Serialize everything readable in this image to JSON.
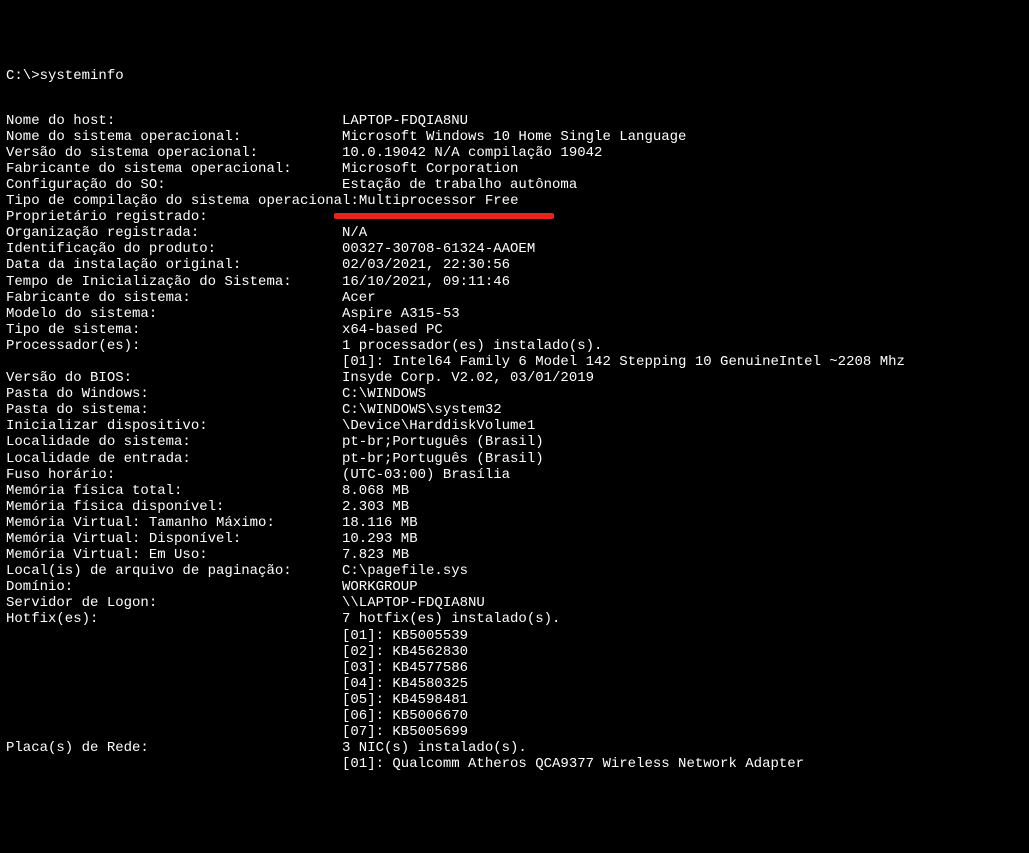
{
  "prompt": "C:\\>systeminfo",
  "rows": [
    {
      "label": "Nome do host:",
      "value": "LAPTOP-FDQIA8NU"
    },
    {
      "label": "Nome do sistema operacional:",
      "value": "Microsoft Windows 10 Home Single Language"
    },
    {
      "label": "Versão do sistema operacional:",
      "value": "10.0.19042 N/A compilação 19042"
    },
    {
      "label": "Fabricante do sistema operacional:",
      "value": "Microsoft Corporation"
    },
    {
      "label": "Configuração do SO:",
      "value": "Estação de trabalho autônoma"
    },
    {
      "label": "Tipo de compilação do sistema operacional:",
      "value": "Multiprocessor Free"
    },
    {
      "label": "Proprietário registrado:",
      "value": "",
      "redacted": true
    },
    {
      "label": "Organização registrada:",
      "value": "N/A"
    },
    {
      "label": "Identificação do produto:",
      "value": "00327-30708-61324-AAOEM"
    },
    {
      "label": "Data da instalação original:",
      "value": "02/03/2021, 22:30:56"
    },
    {
      "label": "Tempo de Inicialização do Sistema:",
      "value": "16/10/2021, 09:11:46"
    },
    {
      "label": "Fabricante do sistema:",
      "value": "Acer"
    },
    {
      "label": "Modelo do sistema:",
      "value": "Aspire A315-53"
    },
    {
      "label": "Tipo de sistema:",
      "value": "x64-based PC"
    },
    {
      "label": "Processador(es):",
      "value": "1 processador(es) instalado(s)."
    },
    {
      "label": "",
      "value": "[01]: Intel64 Family 6 Model 142 Stepping 10 GenuineIntel ~2208 Mhz",
      "indent": true
    },
    {
      "label": "Versão do BIOS:",
      "value": "Insyde Corp. V2.02, 03/01/2019"
    },
    {
      "label": "Pasta do Windows:",
      "value": "C:\\WINDOWS"
    },
    {
      "label": "Pasta do sistema:",
      "value": "C:\\WINDOWS\\system32"
    },
    {
      "label": "Inicializar dispositivo:",
      "value": "\\Device\\HarddiskVolume1"
    },
    {
      "label": "Localidade do sistema:",
      "value": "pt-br;Português (Brasil)"
    },
    {
      "label": "Localidade de entrada:",
      "value": "pt-br;Português (Brasil)"
    },
    {
      "label": "Fuso horário:",
      "value": "(UTC-03:00) Brasília"
    },
    {
      "label": "Memória física total:",
      "value": "8.068 MB"
    },
    {
      "label": "Memória física disponível:",
      "value": "2.303 MB"
    },
    {
      "label": "Memória Virtual: Tamanho Máximo:",
      "value": "18.116 MB"
    },
    {
      "label": "Memória Virtual: Disponível:",
      "value": "10.293 MB"
    },
    {
      "label": "Memória Virtual: Em Uso:",
      "value": "7.823 MB"
    },
    {
      "label": "Local(is) de arquivo de paginação:",
      "value": "C:\\pagefile.sys"
    },
    {
      "label": "Domínio:",
      "value": "WORKGROUP"
    },
    {
      "label": "Servidor de Logon:",
      "value": "\\\\LAPTOP-FDQIA8NU"
    },
    {
      "label": "Hotfix(es):",
      "value": "7 hotfix(es) instalado(s)."
    },
    {
      "label": "",
      "value": "[01]: KB5005539",
      "indent": true
    },
    {
      "label": "",
      "value": "[02]: KB4562830",
      "indent": true
    },
    {
      "label": "",
      "value": "[03]: KB4577586",
      "indent": true
    },
    {
      "label": "",
      "value": "[04]: KB4580325",
      "indent": true
    },
    {
      "label": "",
      "value": "[05]: KB4598481",
      "indent": true
    },
    {
      "label": "",
      "value": "[06]: KB5006670",
      "indent": true
    },
    {
      "label": "",
      "value": "[07]: KB5005699",
      "indent": true
    },
    {
      "label": "Placa(s) de Rede:",
      "value": "3 NIC(s) instalado(s)."
    },
    {
      "label": "",
      "value": "[01]: Qualcomm Atheros QCA9377 Wireless Network Adapter",
      "indent": true
    }
  ]
}
